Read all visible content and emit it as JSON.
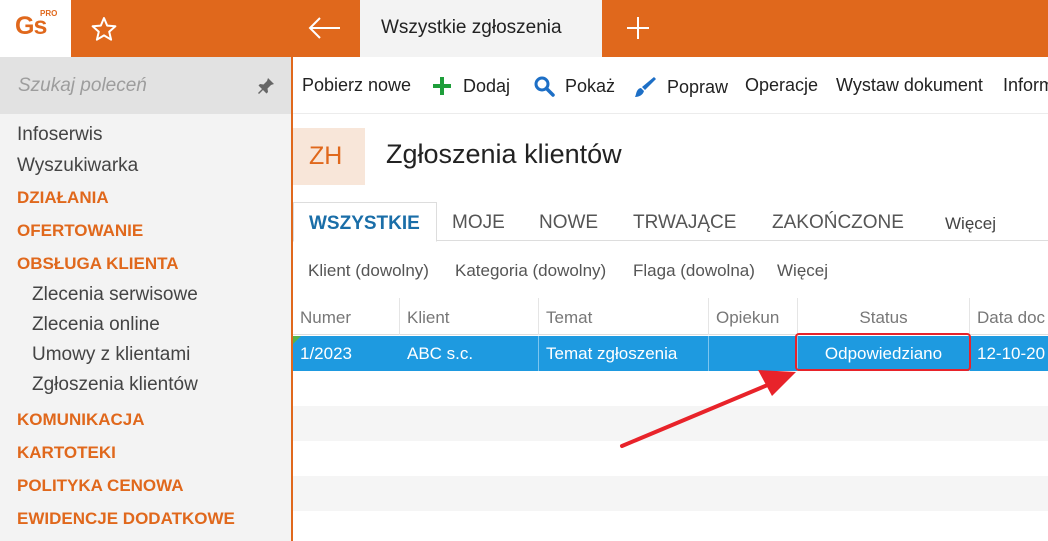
{
  "app": {
    "logo_text": "Gs",
    "logo_badge": "PRO"
  },
  "header": {
    "active_tab": "Wszystkie zgłoszenia"
  },
  "sidebar": {
    "search_placeholder": "Szukaj poleceń",
    "items": [
      {
        "label": "Infoserwis",
        "kind": "item"
      },
      {
        "label": "Wyszukiwarka",
        "kind": "item"
      },
      {
        "label": "DZIAŁANIA",
        "kind": "head"
      },
      {
        "label": "OFERTOWANIE",
        "kind": "head"
      },
      {
        "label": "OBSŁUGA KLIENTA",
        "kind": "head"
      },
      {
        "label": "Zlecenia serwisowe",
        "kind": "sub"
      },
      {
        "label": "Zlecenia online",
        "kind": "sub"
      },
      {
        "label": "Umowy z klientami",
        "kind": "sub"
      },
      {
        "label": "Zgłoszenia klientów",
        "kind": "sub"
      },
      {
        "label": "KOMUNIKACJA",
        "kind": "head"
      },
      {
        "label": "KARTOTEKI",
        "kind": "head"
      },
      {
        "label": "POLITYKA CENOWA",
        "kind": "head"
      },
      {
        "label": "EWIDENCJE DODATKOWE",
        "kind": "head"
      }
    ]
  },
  "toolbar": {
    "download_new": "Pobierz nowe",
    "add": "Dodaj",
    "show": "Pokaż",
    "edit": "Popraw",
    "operations": "Operacje",
    "issue_document": "Wystaw dokument",
    "info": "Inform"
  },
  "page": {
    "badge": "ZH",
    "title": "Zgłoszenia klientów"
  },
  "tabs": {
    "all": "WSZYSTKIE",
    "mine": "MOJE",
    "new": "NOWE",
    "ongoing": "TRWAJĄCE",
    "finished": "ZAKOŃCZONE",
    "more": "Więcej"
  },
  "filters": {
    "client": "Klient (dowolny)",
    "category": "Kategoria (dowolny)",
    "flag": "Flaga (dowolna)",
    "more": "Więcej"
  },
  "table": {
    "columns": [
      "Numer",
      "Klient",
      "Temat",
      "Opiekun",
      "Status",
      "Data doc"
    ],
    "rows": [
      {
        "number": "1/2023",
        "client": "ABC s.c.",
        "subject": "Temat zgłoszenia",
        "owner": "",
        "status": "Odpowiedziano",
        "date": "12-10-20"
      }
    ]
  },
  "colors": {
    "accent": "#e0681c",
    "selection": "#1e9ae0",
    "highlight": "#e8232a",
    "tab_active": "#1a6ea8"
  }
}
